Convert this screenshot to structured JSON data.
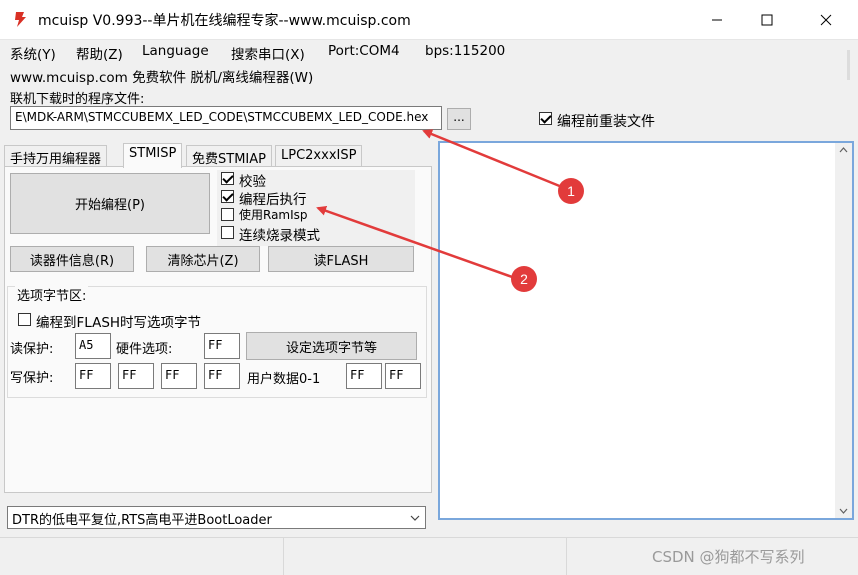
{
  "window": {
    "title": "mcuisp V0.993--单片机在线编程专家--www.mcuisp.com"
  },
  "menu": {
    "items": [
      "系统(Y)",
      "帮助(Z)",
      "Language",
      "搜索串口(X)",
      "Port:COM4",
      "bps:115200"
    ],
    "second_line": "www.mcuisp.com 免费软件 脱机/离线编程器(W)"
  },
  "file": {
    "label": "联机下载时的程序文件:",
    "path": "E\\MDK-ARM\\STMCCUBEMX_LED_CODE\\STMCCUBEMX_LED_CODE.hex",
    "browse_label": "...",
    "reload_label": "编程前重装文件",
    "reload_checked": true
  },
  "tabs": [
    {
      "label": "手持万用编程器",
      "active": false
    },
    {
      "label": "STMISP",
      "active": true
    },
    {
      "label": "免费STMIAP",
      "active": false
    },
    {
      "label": "LPC2xxxISP",
      "active": false
    }
  ],
  "stmisp": {
    "start_button": "开始编程(P)",
    "options": [
      {
        "label": "校验",
        "checked": true
      },
      {
        "label": "编程后执行",
        "checked": true
      },
      {
        "label": "使用RamIsp",
        "checked": false
      },
      {
        "label": "连续烧录模式",
        "checked": false
      }
    ],
    "read_info_button": "读器件信息(R)",
    "erase_button": "清除芯片(Z)",
    "read_flash_button": "读FLASH"
  },
  "option_bytes": {
    "group_title": "选项字节区:",
    "write_option_label": "编程到FLASH时写选项字节",
    "write_option_checked": false,
    "read_protect_label": "读保护:",
    "read_protect_value": "A5",
    "hw_option_label": "硬件选项:",
    "hw_option_value": "FF",
    "set_button": "设定选项字节等",
    "write_protect_label": "写保护:",
    "write_protect_values": [
      "FF",
      "FF",
      "FF",
      "FF"
    ],
    "user_data_label": "用户数据0-1",
    "user_data_values": [
      "FF",
      "FF"
    ]
  },
  "boot_mode": {
    "selected": "DTR的低电平复位,RTS高电平进BootLoader"
  },
  "annotations": {
    "marker_1": "1",
    "marker_2": "2",
    "arrow_color": "#e23b3b"
  },
  "watermark": "CSDN @狗都不写系列"
}
